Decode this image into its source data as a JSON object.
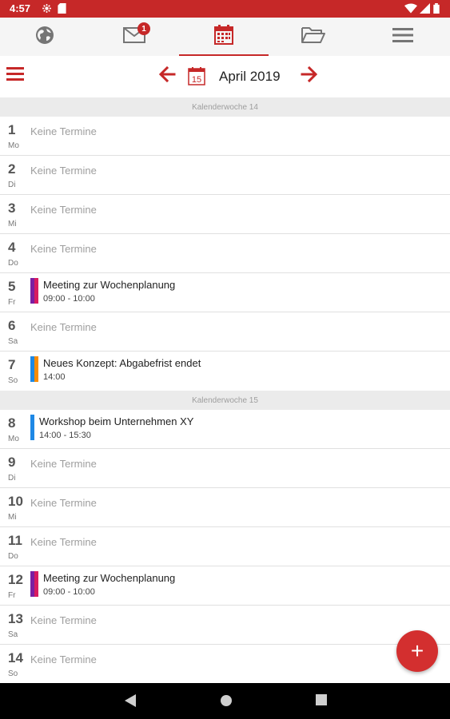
{
  "status_bar": {
    "time": "4:57"
  },
  "tabs": [
    {
      "icon": "globe-icon"
    },
    {
      "icon": "mail-icon",
      "badge": "1"
    },
    {
      "icon": "calendar-icon",
      "active": true
    },
    {
      "icon": "folder-icon"
    },
    {
      "icon": "menu-icon"
    }
  ],
  "header": {
    "month": "April 2019",
    "date_icon_day": "15"
  },
  "empty_text": "Keine Termine",
  "weeks": [
    {
      "label": "Kalenderwoche 14",
      "days": [
        {
          "num": "1",
          "abbr": "Mo",
          "events": []
        },
        {
          "num": "2",
          "abbr": "Di",
          "events": []
        },
        {
          "num": "3",
          "abbr": "Mi",
          "events": []
        },
        {
          "num": "4",
          "abbr": "Do",
          "events": []
        },
        {
          "num": "5",
          "abbr": "Fr",
          "events": [
            {
              "title": "Meeting zur Wochenplanung",
              "time": "09:00 - 10:00",
              "colors": [
                "#7b1fa2",
                "#d81b60"
              ]
            }
          ]
        },
        {
          "num": "6",
          "abbr": "Sa",
          "events": []
        },
        {
          "num": "7",
          "abbr": "So",
          "events": [
            {
              "title": "Neues Konzept: Abgabefrist endet",
              "time": "14:00",
              "colors": [
                "#1e88e5",
                "#fb8c00"
              ]
            }
          ]
        }
      ]
    },
    {
      "label": "Kalenderwoche 15",
      "days": [
        {
          "num": "8",
          "abbr": "Mo",
          "events": [
            {
              "title": "Workshop beim Unternehmen XY",
              "time": "14:00 - 15:30",
              "colors": [
                "#1e88e5"
              ]
            }
          ]
        },
        {
          "num": "9",
          "abbr": "Di",
          "events": []
        },
        {
          "num": "10",
          "abbr": "Mi",
          "events": []
        },
        {
          "num": "11",
          "abbr": "Do",
          "events": []
        },
        {
          "num": "12",
          "abbr": "Fr",
          "events": [
            {
              "title": "Meeting zur Wochenplanung",
              "time": "09:00 - 10:00",
              "colors": [
                "#7b1fa2",
                "#d81b60"
              ]
            }
          ]
        },
        {
          "num": "13",
          "abbr": "Sa",
          "events": []
        },
        {
          "num": "14",
          "abbr": "So",
          "events": []
        }
      ]
    }
  ],
  "fab": {
    "label": "+"
  },
  "colors": {
    "accent": "#c62828"
  }
}
